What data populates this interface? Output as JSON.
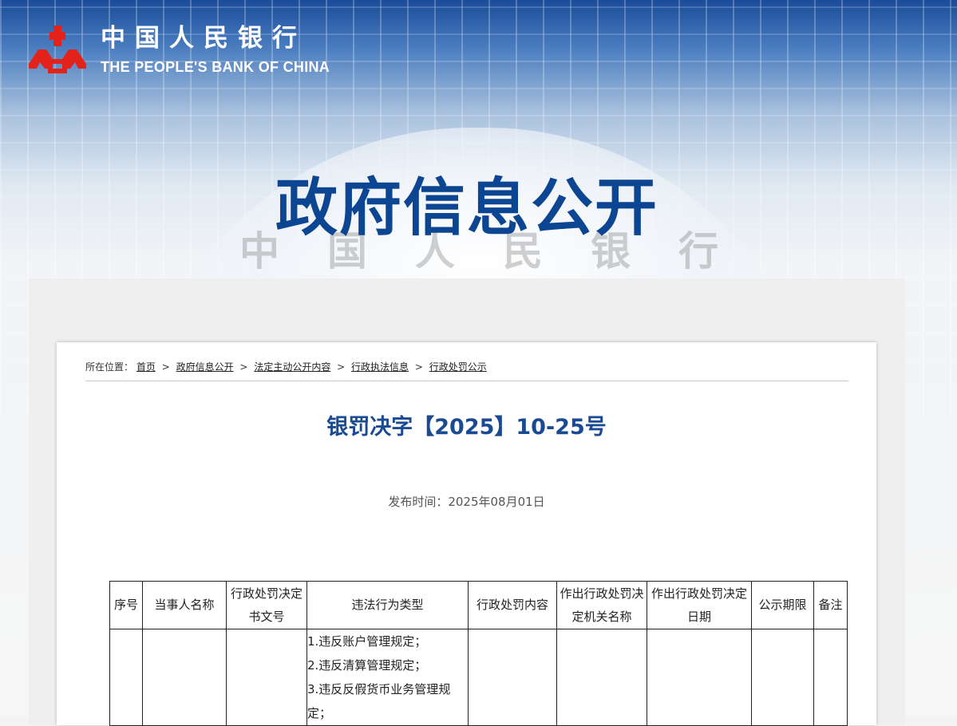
{
  "site": {
    "logo_cn": "中国人民银行",
    "logo_en": "THE PEOPLE'S BANK OF CHINA",
    "banner_title": "政府信息公开",
    "watermark_chars": [
      "中",
      "国",
      "人",
      "民",
      "银",
      "行"
    ],
    "brand_color": "#0c4591",
    "logo_color": "#e3231a"
  },
  "breadcrumb": {
    "prefix": "所在位置：",
    "items": [
      "首页",
      "政府信息公开",
      "法定主动公开内容",
      "行政执法信息",
      "行政处罚公示"
    ],
    "separator": ">"
  },
  "document": {
    "title": "银罚决字【2025】10-25号",
    "publish_time": "发布时间：2025年08月01日"
  },
  "table": {
    "headers": [
      "序号",
      "当事人名称",
      "行政处罚决定书文号",
      "违法行为类型",
      "行政处罚内容",
      "作出行政处罚决定机关名称",
      "作出行政处罚决定日期",
      "公示期限",
      "备注"
    ],
    "row1": {
      "violations": [
        "1.违反账户管理规定；",
        "2.违反清算管理规定；",
        "3.违反反假货币业务管理规定；"
      ]
    }
  }
}
